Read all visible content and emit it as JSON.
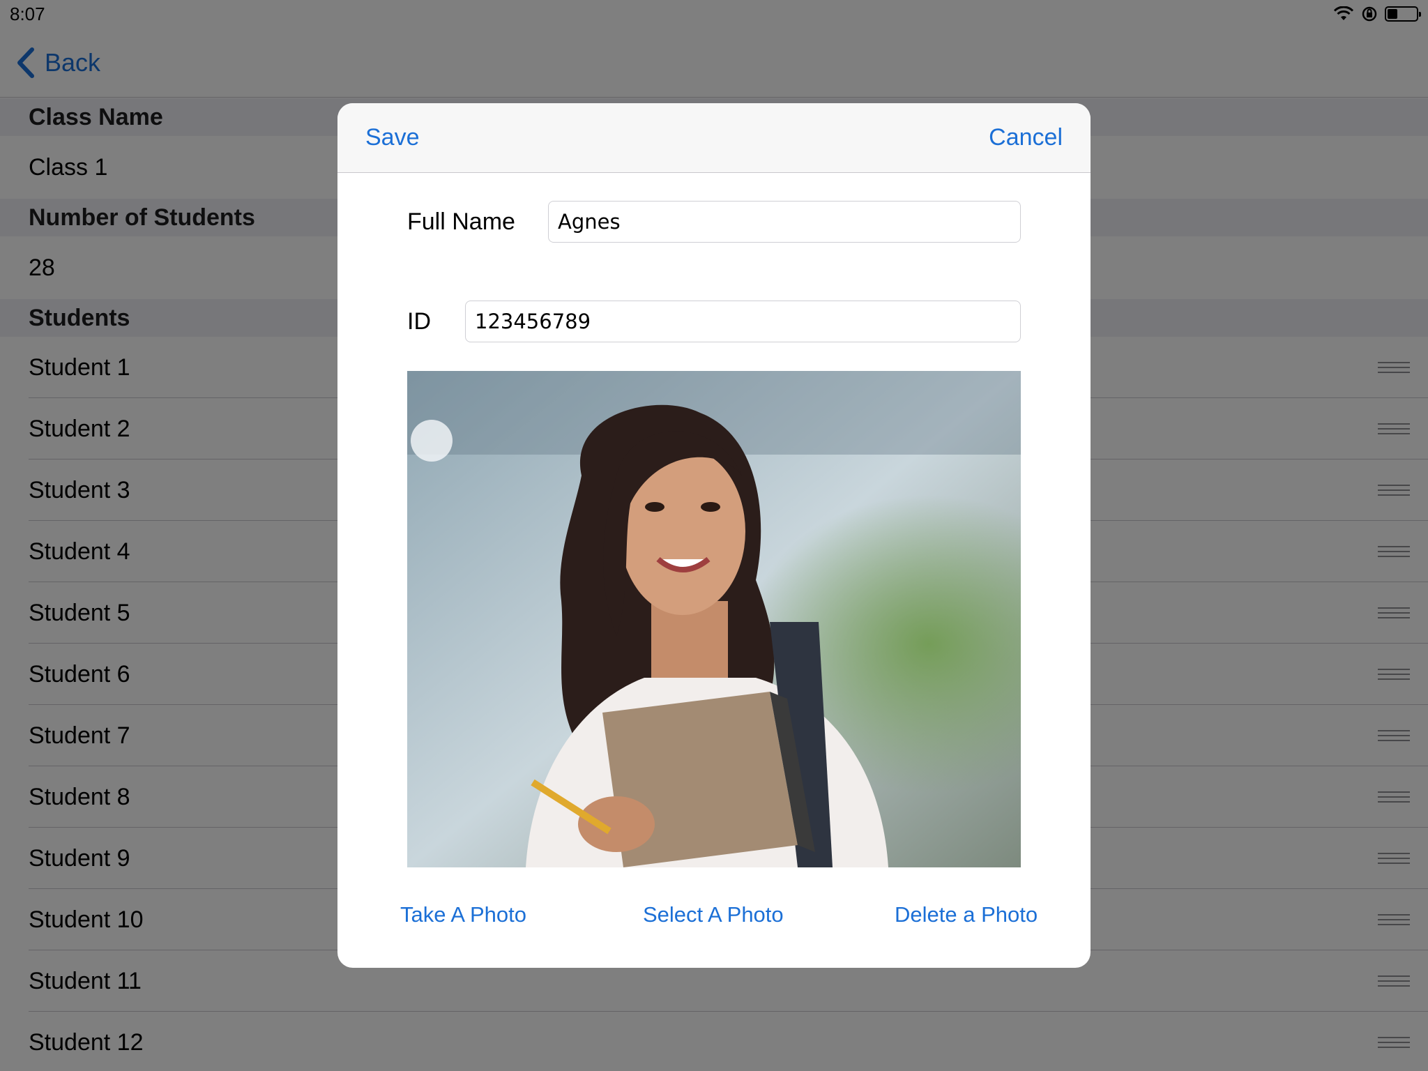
{
  "status": {
    "time": "8:07"
  },
  "nav": {
    "back_label": "Back"
  },
  "class_name": {
    "header": "Class Name",
    "value": "Class 1"
  },
  "num_students": {
    "header": "Number of Students",
    "value": "28"
  },
  "students": {
    "header": "Students",
    "rows": [
      "Student 1",
      "Student 2",
      "Student 3",
      "Student 4",
      "Student 5",
      "Student 6",
      "Student 7",
      "Student 8",
      "Student 9",
      "Student 10",
      "Student 11",
      "Student 12"
    ]
  },
  "modal": {
    "save_label": "Save",
    "cancel_label": "Cancel",
    "full_name_label": "Full Name",
    "full_name_value": "Agnes",
    "id_label": "ID",
    "id_value": "123456789",
    "take_photo_label": "Take A Photo",
    "select_photo_label": "Select A Photo",
    "delete_photo_label": "Delete a Photo"
  },
  "icons": {
    "back": "chevron-left-icon",
    "wifi": "wifi-icon",
    "lock_rotation": "rotation-lock-icon",
    "battery": "battery-icon",
    "reorder": "reorder-handle-icon"
  },
  "colors": {
    "accent": "#1b6fd6",
    "section_bg": "#efeff4"
  }
}
